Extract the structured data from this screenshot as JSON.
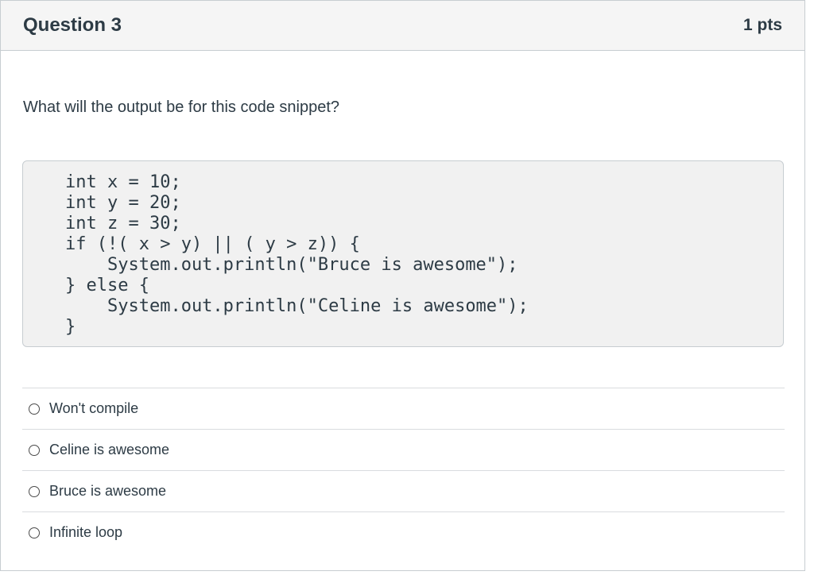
{
  "question": {
    "title": "Question 3",
    "points": "1 pts",
    "prompt": "What will the output be for this code snippet?",
    "code": "int x = 10;\nint y = 20;\nint z = 30;\nif (!( x > y) || ( y > z)) {\n    System.out.println(\"Bruce is awesome\");\n} else {\n    System.out.println(\"Celine is awesome\");\n}",
    "answers": [
      {
        "label": "Won't compile",
        "selected": false
      },
      {
        "label": "Celine is awesome",
        "selected": false
      },
      {
        "label": "Bruce is awesome",
        "selected": false
      },
      {
        "label": "Infinite loop",
        "selected": false
      }
    ]
  },
  "colors": {
    "text": "#2d3b45",
    "header_bg": "#f5f5f5",
    "code_bg": "#f1f1f1",
    "border": "#c7cdd1"
  }
}
